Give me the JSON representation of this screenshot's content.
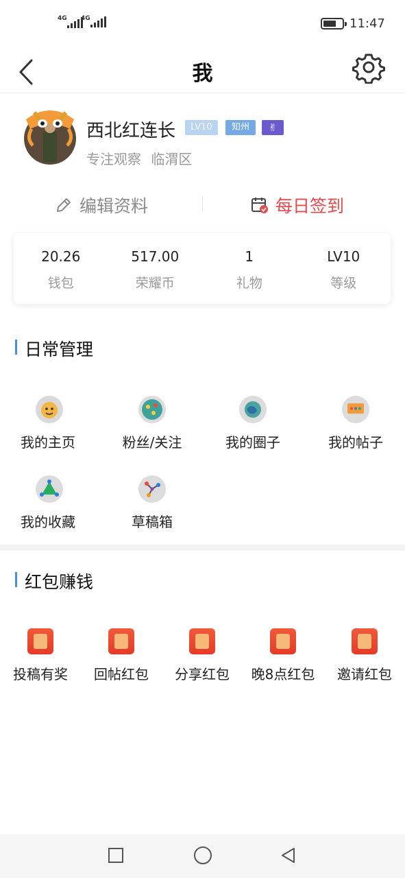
{
  "status_bar": {
    "signal1": "4G",
    "signal2": "4G",
    "battery_level": 0.7,
    "time": "11:47"
  },
  "header": {
    "title": "我"
  },
  "profile": {
    "nickname": "西北红连长",
    "badges": [
      "LV10",
      "知州",
      "✌"
    ],
    "motto": "专注观察",
    "district": "临渭区"
  },
  "actions": {
    "edit": "编辑资料",
    "checkin": "每日签到"
  },
  "stats": [
    {
      "value": "20.26",
      "label": "钱包"
    },
    {
      "value": "517.00",
      "label": "荣耀币"
    },
    {
      "value": "1",
      "label": "礼物"
    },
    {
      "value": "LV10",
      "label": "等级"
    }
  ],
  "daily": {
    "title": "日常管理",
    "items": [
      {
        "label": "我的主页",
        "icon": "face-icon"
      },
      {
        "label": "粉丝/关注",
        "icon": "fans-icon"
      },
      {
        "label": "我的圈子",
        "icon": "globe-icon"
      },
      {
        "label": "我的帖子",
        "icon": "chat-icon"
      },
      {
        "label": "我的收藏",
        "icon": "triangle-icon"
      },
      {
        "label": "草稿箱",
        "icon": "nodes-icon"
      }
    ]
  },
  "redpacket": {
    "title": "红包赚钱",
    "items": [
      {
        "label": "投稿有奖",
        "icon": "red-packet-icon"
      },
      {
        "label": "回帖红包",
        "icon": "red-packet-icon"
      },
      {
        "label": "分享红包",
        "icon": "red-packet-icon"
      },
      {
        "label": "晚8点红包",
        "icon": "red-packet-icon"
      },
      {
        "label": "邀请红包",
        "icon": "red-packet-icon"
      }
    ]
  },
  "colors": {
    "accent_red": "#e5484d",
    "section_bar": "#4a90d9"
  }
}
